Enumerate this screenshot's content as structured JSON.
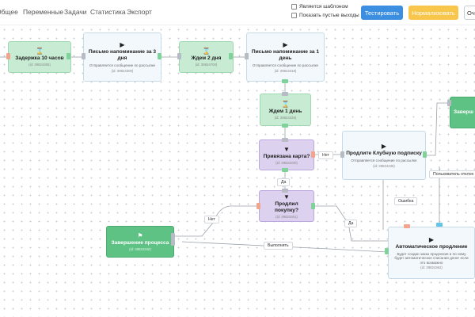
{
  "nav": {
    "general": "Общее",
    "variables": "Переменные",
    "tasks": "Задачи",
    "statistics": "Статистика",
    "export": "Экспорт"
  },
  "options": {
    "is_template": "Является шаблоном",
    "show_empty_outputs": "Показать пустые выходы"
  },
  "buttons": {
    "test": "Тестировать",
    "normalize": "Нормализовать",
    "third": "Оч"
  },
  "colors": {
    "test_button": "#3b8ee0",
    "normalize_button": "#f7c64a",
    "timer_node": "#c8ecd3",
    "filter_node": "#dcd1ee",
    "action_node": "#f3f8fc",
    "end_node": "#5fc285"
  },
  "nodes": {
    "delay10": {
      "icon": "hourglass-icon",
      "title": "Задержка 10 часов",
      "id": "(id: 39824306)"
    },
    "letter3": {
      "icon": "play-icon",
      "title": "Письмо напоминание за 3 дня",
      "desc": "Отправляется сообщение по рассылке",
      "id": "(id: 39824300)"
    },
    "wait2": {
      "icon": "hourglass-icon",
      "title": "Ждем 2 дня",
      "id": "(id: 39824700)"
    },
    "letter1": {
      "icon": "play-icon",
      "title": "Письмо напоминание за 1 день",
      "desc": "Отправляется сообщение по рассылке",
      "id": "(id: 39824318)"
    },
    "wait1": {
      "icon": "hourglass-icon",
      "title": "Ждем 1 день",
      "id": "(id: 39824326)"
    },
    "card": {
      "icon": "filter-icon",
      "title": "Привязана карта?",
      "id": "(id: 39824330)"
    },
    "club": {
      "icon": "play-icon",
      "title": "Продлите Клубную подписку",
      "desc": "Отправляется сообщение по рассылке",
      "id": "(id: 39824336)"
    },
    "purchase": {
      "icon": "filter-icon",
      "title": "Продлил покупку?",
      "id": "(id: 39824351)"
    },
    "end_process": {
      "icon": "flag-icon",
      "title": "Завершение процесса",
      "id": "(id: 39824340)"
    },
    "auto": {
      "icon": "play-icon",
      "title": "Автоматическое продление",
      "desc": "Будет создан заказ продления и по нему будет автоматическое списание денег если это возможно",
      "id": "(id: 39824362)"
    },
    "end_right": {
      "title": "Заверш"
    }
  },
  "edge_labels": {
    "no_card": "Нет",
    "yes_card": "Да",
    "no_purchase": "Нет",
    "yes_purchase": "Да",
    "error": "Ошибка",
    "done": "Выполнить",
    "user_cancel": "Пользователь отклон"
  }
}
